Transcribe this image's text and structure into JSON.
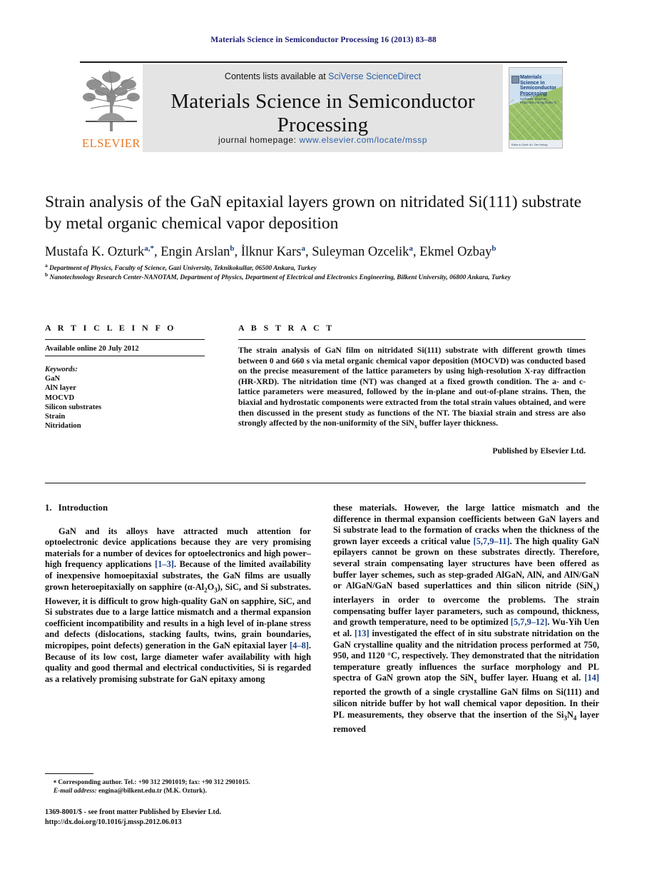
{
  "running_head": "Materials Science in Semiconductor Processing 16 (2013) 83–88",
  "masthead": {
    "publisher_logo_text": "ELSEVIER",
    "contents_prefix": "Contents lists available at ",
    "contents_link": "SciVerse ScienceDirect",
    "journal_title": "Materials Science in Semiconductor Processing",
    "homepage_prefix": "journal homepage: ",
    "homepage_url": "www.elsevier.com/locate/mssp",
    "cover": {
      "title": "Materials Science in Semiconductor Processing",
      "subtitle": "Including papers on Synthesis, Structure, Properties and Applications",
      "footer": "Editor-in-Chief: M.I. Den Hertog"
    }
  },
  "article": {
    "title": "Strain analysis of the GaN epitaxial layers grown on nitridated Si(111) substrate by metal organic chemical vapor deposition",
    "authors": [
      {
        "name": "Mustafa K. Ozturk",
        "sup": "a,*"
      },
      {
        "name": "Engin Arslan",
        "sup": "b"
      },
      {
        "name": "İlknur Kars",
        "sup": "a"
      },
      {
        "name": "Suleyman Ozcelik",
        "sup": "a"
      },
      {
        "name": "Ekmel Ozbay",
        "sup": "b"
      }
    ],
    "affiliations": [
      {
        "label": "a",
        "text": "Department of Physics, Faculty of Science, Gazi University, Teknikokullar, 06500 Ankara, Turkey"
      },
      {
        "label": "b",
        "text": "Nanotechnology Research Center-NANOTAM, Department of Physics, Department of Electrical and Electronics Engineering, Bilkent University, 06800 Ankara, Turkey"
      }
    ]
  },
  "article_info": {
    "heading": "A R T I C L E   I N F O",
    "available_online": "Available online 20 July 2012",
    "keywords_label": "Keywords:",
    "keywords": [
      "GaN",
      "AlN layer",
      "MOCVD",
      "Silicon substrates",
      "Strain",
      "Nitridation"
    ]
  },
  "abstract": {
    "heading": "A B S T R A C T",
    "text_part1": "The strain analysis of GaN film on nitridated Si(111) substrate with different growth times between 0 and 660 s via metal organic chemical vapor deposition (MOCVD) was conducted based on the precise measurement of the lattice parameters by using high-resolution X-ray diffraction (HR-XRD). The nitridation time (NT) was changed at a fixed growth condition. The a- and c-lattice parameters were measured, followed by the in-plane and out-of-plane strains. Then, the biaxial and hydrostatic components were extracted from the total strain values obtained, and were then discussed in the present study as functions of the NT. The biaxial strain and stress are also strongly affected by the non-uniformity of the SiN",
    "subscript": "x",
    "text_part2": " buffer layer thickness.",
    "published_by": "Published by Elsevier Ltd."
  },
  "section1": {
    "number": "1.",
    "title": "Introduction"
  },
  "body": {
    "left_p1_a": "GaN and its alloys have attracted much attention for optoelectronic device applications because they are very promising materials for a number of devices for optoelectronics and high power–high frequency applications ",
    "left_ref1": "[1–3]",
    "left_p1_b": ". Because of the limited availability of inexpensive homoepitaxial substrates, the GaN films are usually grown heteroepitaxially on sapphire (α-Al",
    "left_sub1": "2",
    "left_p1_c": "O",
    "left_sub2": "3",
    "left_p1_d": "), SiC, and Si substrates. However, it is difficult to grow high-quality GaN on sapphire, SiC, and Si substrates due to a large lattice mismatch and a thermal expansion coefficient incompatibility and results in a high level of in-plane stress and defects (dislocations, stacking faults, twins, grain boundaries, micropipes, point defects) generation in the GaN epitaxial layer ",
    "left_ref2": "[4–8]",
    "left_p1_e": ". Because of its low cost, large diameter wafer availability with high quality and good thermal and electrical conductivities, Si is regarded as a relatively promising substrate for GaN epitaxy among",
    "right_p1_a": "these materials. However, the large lattice mismatch and the difference in thermal expansion coefficients between GaN layers and Si substrate lead to the formation of cracks when the thickness of the grown layer exceeds a critical value ",
    "right_ref1": "[5,7,9–11]",
    "right_p1_b": ". The high quality GaN epilayers cannot be grown on these substrates directly. Therefore, several strain compensating layer structures have been offered as buffer layer schemes, such as step-graded AlGaN, AlN, and AlN/GaN or AlGaN/GaN based superlattices and thin silicon nitride (SiN",
    "right_sub1": "x",
    "right_p1_c": ") interlayers in order to overcome the problems. The strain compensating buffer layer parameters, such as compound, thickness, and growth temperature, need to be optimized ",
    "right_ref2": "[5,7,9–12]",
    "right_p1_d": ". Wu-Yih Uen et al. ",
    "right_ref3": "[13]",
    "right_p1_e": " investigated the effect of in situ substrate nitridation on the GaN crystalline quality and the nitridation process performed at 750, 950, and 1120 °C, respectively. They demonstrated that the nitridation temperature greatly influences the surface morphology and PL spectra of GaN grown atop the SiN",
    "right_sub2": "x",
    "right_p1_f": " buffer layer. Huang et al. ",
    "right_ref4": "[14]",
    "right_p1_g": " reported the growth of a single crystalline GaN films on Si(111) and silicon nitride buffer by hot wall chemical vapor deposition. In their PL measurements, they observe that the insertion of the Si",
    "right_sub3": "3",
    "right_p1_h": "N",
    "right_sub4": "4",
    "right_p1_i": " layer removed"
  },
  "footnote": {
    "marker": "⁎",
    "corresponding": "Corresponding author. Tel.: +90 312 2901019; fax: +90 312 2901015.",
    "email_label": "E-mail address:",
    "email": " engina@bilkent.edu.tr (M.K. Ozturk)."
  },
  "frontmatter": {
    "line1": "1369-8001/$ - see front matter Published by Elsevier Ltd.",
    "line2": "http://dx.doi.org/10.1016/j.mssp.2012.06.013"
  },
  "colors": {
    "link": "#2b5fa8",
    "reference": "#1a3f87",
    "runhead": "#1a1a6e",
    "elsevier_orange": "#E87722",
    "banner_bg": "#e4e4e4"
  }
}
